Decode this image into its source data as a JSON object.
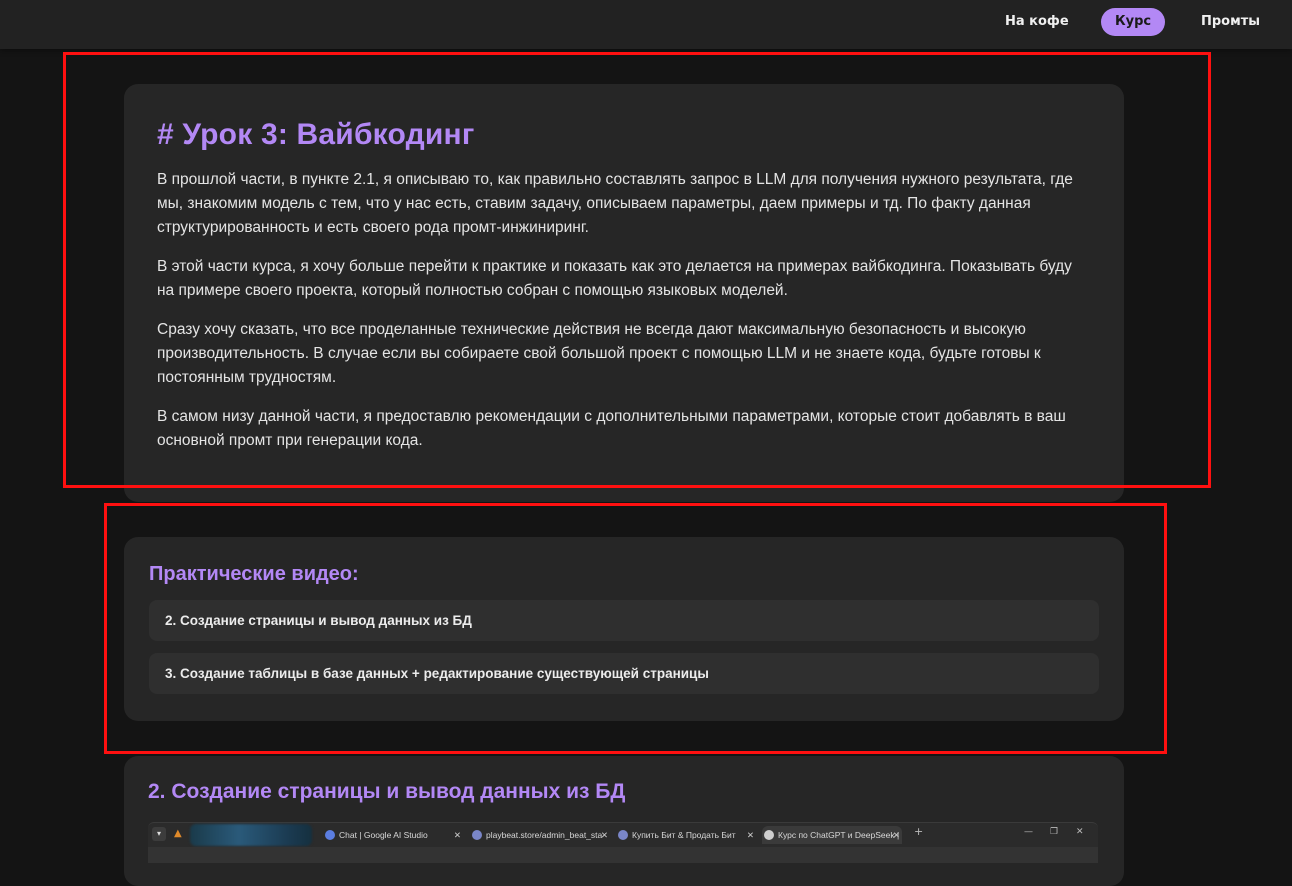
{
  "nav": {
    "items": [
      {
        "label": "На кофе",
        "active": false
      },
      {
        "label": "Курс",
        "active": true
      },
      {
        "label": "Промты",
        "active": false
      }
    ],
    "accent_color": "#b388f5"
  },
  "lesson": {
    "title": "# Урок 3: Вайбкодинг",
    "paragraphs": [
      "В прошлой части, в пункте 2.1, я описываю то, как правильно составлять запрос в LLM для получения нужного результата, где мы, знакомим модель с тем, что у нас есть, ставим задачу, описываем параметры, даем примеры и тд. По факту данная структурированность и есть своего рода промт-инжиниринг.",
      "В этой части курса, я хочу больше перейти к практике и показать как это делается на примерах вайбкодинга. Показывать буду на примере своего проекта, который полностью собран с помощью языковых моделей.",
      "Сразу хочу сказать, что все проделанные технические действия не всегда дают максимальную безопасность и высокую производительность. В случае если вы собираете свой большой проект с помощью LLM и не знаете кода, будьте готовы к постоянным трудностям.",
      "В самом низу данной части, я предоставлю рекомендации с дополнительными параметрами, которые стоит добавлять в ваш основной промт при генерации кода."
    ]
  },
  "videos": {
    "title": "Практические видео:",
    "items": [
      "2. Создание страницы и вывод данных из БД",
      "3. Создание таблицы в базе данных + редактирование существующей страницы"
    ]
  },
  "video_section": {
    "title": "2. Создание страницы и вывод данных из БД",
    "browser_tabs": [
      {
        "label": "Chat | Google AI Studio",
        "icon": "ai-studio-icon"
      },
      {
        "label": "playbeat.store/admin_beat_sta",
        "icon": "globe-icon"
      },
      {
        "label": "Купить Бит & Продать Бит",
        "icon": "globe-icon"
      },
      {
        "label": "Курс по ChatGPT и DeepSeek |",
        "icon": "globe-icon"
      }
    ],
    "new_tab_glyph": "+"
  },
  "highlight_color": "#ff1010"
}
